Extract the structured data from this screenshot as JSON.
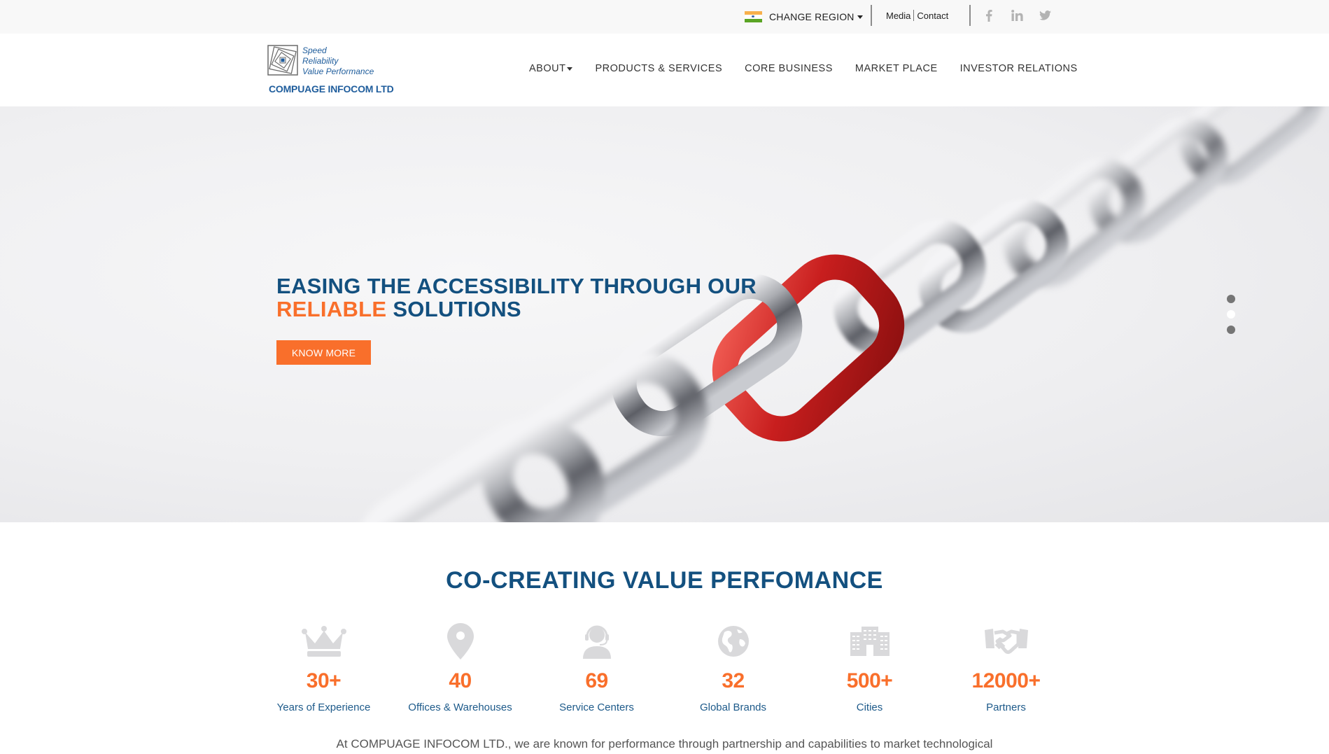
{
  "topbar": {
    "region_flag": "india-flag-icon",
    "region_label": "CHANGE REGION",
    "links": [
      "Media",
      "Contact"
    ],
    "social": [
      "facebook-icon",
      "linkedin-icon",
      "twitter-icon"
    ]
  },
  "header": {
    "logo": {
      "tagline": [
        "Speed",
        "Reliability",
        "Value Performance"
      ],
      "company": "COMPUAGE INFOCOM LTD"
    },
    "nav": [
      {
        "label": "ABOUT",
        "has_dropdown": true
      },
      {
        "label": "PRODUCTS & SERVICES",
        "has_dropdown": false
      },
      {
        "label": "CORE BUSINESS",
        "has_dropdown": false
      },
      {
        "label": "MARKET PLACE",
        "has_dropdown": false
      },
      {
        "label": "INVESTOR RELATIONS",
        "has_dropdown": false
      }
    ]
  },
  "hero": {
    "title_line1": "EASING THE ACCESSIBILITY THROUGH OUR",
    "title_accent": "RELIABLE",
    "title_rest": "SOLUTIONS",
    "button_label": "KNOW MORE",
    "slides_total": 3,
    "active_slide": 2
  },
  "stats_section": {
    "title": "CO-CREATING VALUE PERFOMANCE",
    "items": [
      {
        "icon": "crown-icon",
        "value": "30+",
        "label": "Years of Experience"
      },
      {
        "icon": "map-pin-icon",
        "value": "40",
        "label": "Offices & Warehouses"
      },
      {
        "icon": "headset-agent-icon",
        "value": "69",
        "label": "Service Centers"
      },
      {
        "icon": "globe-icon",
        "value": "32",
        "label": "Global Brands"
      },
      {
        "icon": "building-icon",
        "value": "500+",
        "label": "Cities"
      },
      {
        "icon": "handshake-icon",
        "value": "12000+",
        "label": "Partners"
      }
    ],
    "intro_text": "At COMPUAGE INFOCOM LTD., we are known for performance through partnership and capabilities to market technological"
  },
  "colors": {
    "brand_blue": "#13507f",
    "accent_orange": "#f96f2b",
    "icon_gray": "#d9d9db"
  }
}
